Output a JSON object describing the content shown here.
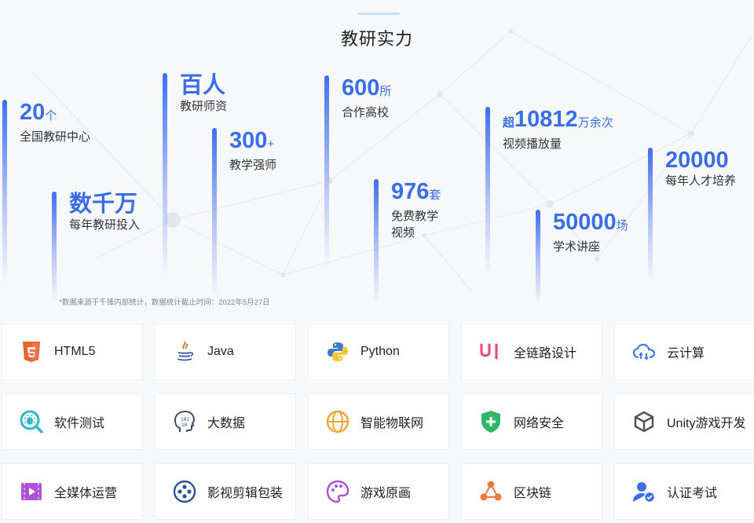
{
  "section_title": "教研实力",
  "stats": [
    {
      "prefix": "",
      "value": "20",
      "unit": "个",
      "desc": [
        "全国教研中心"
      ]
    },
    {
      "prefix": "",
      "value": "数千万",
      "unit": "",
      "desc": [
        "每年教研投入"
      ]
    },
    {
      "prefix": "",
      "value": "百人",
      "unit": "",
      "desc": [
        "教研师资"
      ]
    },
    {
      "prefix": "",
      "value": "300",
      "unit": "+",
      "desc": [
        "教学强师"
      ]
    },
    {
      "prefix": "",
      "value": "600",
      "unit": "所",
      "desc": [
        "合作高校"
      ]
    },
    {
      "prefix": "",
      "value": "976",
      "unit": "套",
      "desc": [
        "免费教学",
        "视频"
      ]
    },
    {
      "prefix": "超",
      "value": "10812",
      "unit": "万余次",
      "desc": [
        "视频播放量"
      ]
    },
    {
      "prefix": "",
      "value": "50000",
      "unit": "场",
      "desc": [
        "学术讲座"
      ]
    },
    {
      "prefix": "",
      "value": "20000",
      "unit": "",
      "desc": [
        "每年人才培养"
      ]
    }
  ],
  "footnote": "*数据来源于千锋内部统计，数据统计截止时间：2022年5月27日",
  "courses": [
    {
      "label": "HTML5",
      "icon": "html5-icon"
    },
    {
      "label": "Java",
      "icon": "java-icon"
    },
    {
      "label": "Python",
      "icon": "python-icon"
    },
    {
      "label": "全链路设计",
      "icon": "ui-design-icon"
    },
    {
      "label": "云计算",
      "icon": "cloud-icon"
    },
    {
      "label": "软件测试",
      "icon": "bug-search-icon"
    },
    {
      "label": "大数据",
      "icon": "big-data-head-icon"
    },
    {
      "label": "智能物联网",
      "icon": "globe-icon"
    },
    {
      "label": "网络安全",
      "icon": "shield-icon"
    },
    {
      "label": "Unity游戏开发",
      "icon": "unity-icon"
    },
    {
      "label": "全媒体运营",
      "icon": "film-play-icon"
    },
    {
      "label": "影视剪辑包装",
      "icon": "film-reel-icon"
    },
    {
      "label": "游戏原画",
      "icon": "palette-icon"
    },
    {
      "label": "区块链",
      "icon": "blockchain-icon"
    },
    {
      "label": "认证考试",
      "icon": "user-check-icon"
    }
  ],
  "colors": {
    "accent": "#3a6ee8",
    "card_bg": "#ffffff"
  }
}
